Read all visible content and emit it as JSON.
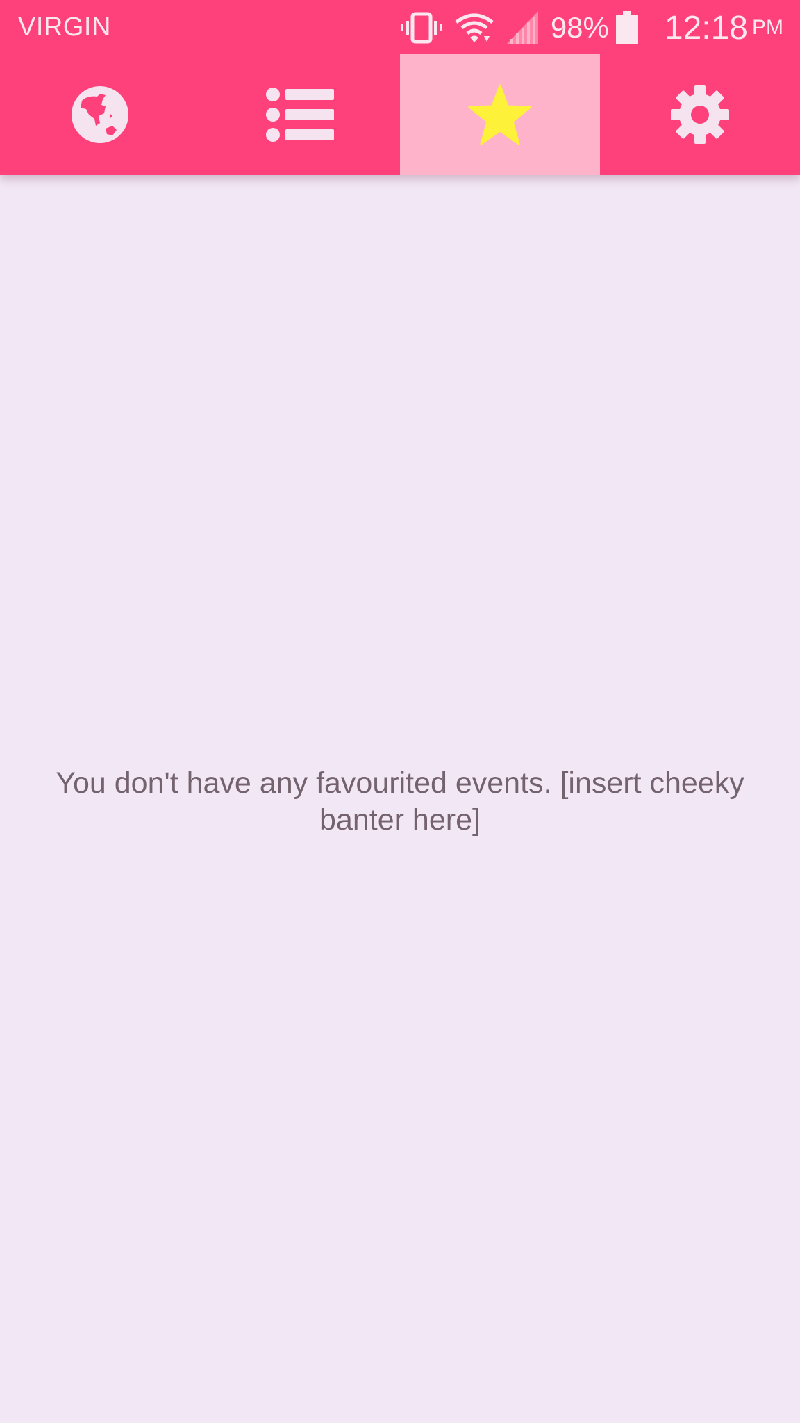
{
  "status_bar": {
    "carrier": "VIRGIN",
    "battery_percent": "98%",
    "time": "12:18",
    "ampm": "PM",
    "icons": [
      "vibrate-icon",
      "wifi-icon",
      "cell-signal-icon",
      "battery-icon"
    ]
  },
  "tabs": [
    {
      "icon": "globe-icon",
      "active": false
    },
    {
      "icon": "list-icon",
      "active": false
    },
    {
      "icon": "star-icon",
      "active": true
    },
    {
      "icon": "gear-icon",
      "active": false
    }
  ],
  "main": {
    "empty_message": "You don't have any favourited events. [insert cheeky banter here]"
  },
  "colors": {
    "app_bar": "#ff417b",
    "active_tab": "#ffb3cb",
    "background": "#f2e7f4",
    "star": "#fdf13a",
    "icon": "#f5e3ef",
    "message_text": "#74636f"
  }
}
